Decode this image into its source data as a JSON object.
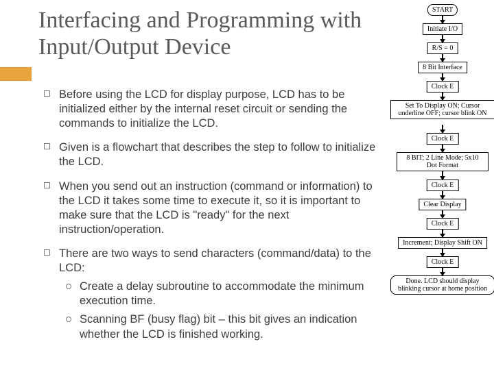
{
  "title": "Interfacing and Programming with Input/Output Device",
  "bullets": [
    "Before using the LCD for display purpose, LCD has to be initialized either by the internal reset circuit or sending the commands to initialize the LCD.",
    "Given is a flowchart that describes the step to follow to initialize the LCD.",
    "When you send out an instruction (command or information) to the LCD it takes some time to execute it, so it is important to make sure that the LCD is \"ready\" for the next instruction/operation.",
    "There are two ways to send characters (command/data) to the LCD:"
  ],
  "subbullets": [
    "Create a delay subroutine to accommodate the minimum execution time.",
    "Scanning BF (busy flag) bit – this bit gives an indication whether the LCD is finished working."
  ],
  "flow": {
    "n0": "START",
    "n1": "Initiate I/O",
    "n2": "R/S = 0",
    "n3": "8 Bit Interface",
    "n4": "Clock E",
    "n5": "Set To Display ON; Cursor underline OFF; cursor blink ON",
    "n6": "Clock E",
    "n7": "8 BIT; 2 Line Mode; 5x10 Dot Format",
    "n8": "Clock E",
    "n9": "Clear Display",
    "n10": "Clock E",
    "n11": "Increment; Display Shift ON",
    "n12": "Clock E",
    "n13": "Done. LCD should display blinking cursor at home position"
  }
}
